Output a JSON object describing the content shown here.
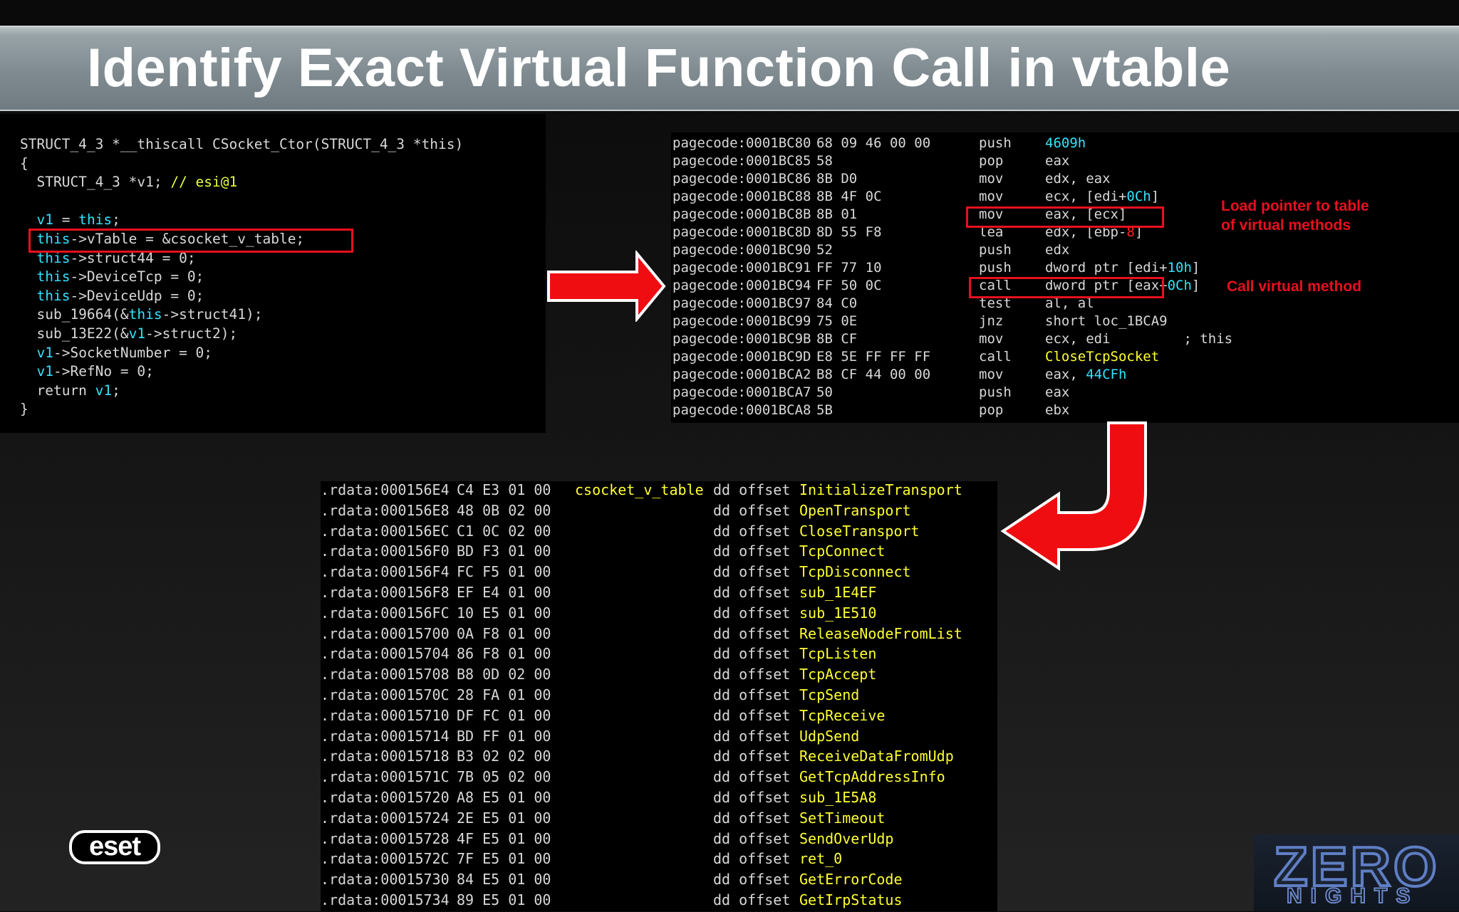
{
  "slide": {
    "title": "Identify Exact Virtual Function Call in vtable"
  },
  "annotations": {
    "load_pointer": [
      "Load pointer to table",
      "of virtual methods"
    ],
    "call_virtual": "Call virtual method"
  },
  "decompiled": {
    "lines": [
      [
        [
          "STRUCT_4_3 *__thiscall CSocket_Ctor(STRUCT_4_3 *this)",
          ""
        ]
      ],
      [
        [
          "{",
          ""
        ]
      ],
      [
        [
          "  STRUCT_4_3 *v1; ",
          ""
        ],
        [
          "// esi@1",
          "cm"
        ]
      ],
      [
        [
          "",
          ""
        ]
      ],
      [
        [
          "  ",
          ""
        ],
        [
          "v1",
          "kw"
        ],
        [
          " = ",
          ""
        ],
        [
          "this",
          "kw"
        ],
        [
          ";",
          ""
        ]
      ],
      [
        [
          "  ",
          ""
        ],
        [
          "this",
          "kw"
        ],
        [
          "->vTable = &csocket_v_table;",
          ""
        ]
      ],
      [
        [
          "  ",
          ""
        ],
        [
          "this",
          "kw"
        ],
        [
          "->struct44 = 0;",
          ""
        ]
      ],
      [
        [
          "  ",
          ""
        ],
        [
          "this",
          "kw"
        ],
        [
          "->DeviceTcp = 0;",
          ""
        ]
      ],
      [
        [
          "  ",
          ""
        ],
        [
          "this",
          "kw"
        ],
        [
          "->DeviceUdp = 0;",
          ""
        ]
      ],
      [
        [
          "  sub_19664(&",
          ""
        ],
        [
          "this",
          "kw"
        ],
        [
          "->struct41);",
          ""
        ]
      ],
      [
        [
          "  sub_13E22(&",
          ""
        ],
        [
          "v1",
          "kw"
        ],
        [
          "->struct2);",
          ""
        ]
      ],
      [
        [
          "  ",
          ""
        ],
        [
          "v1",
          "kw"
        ],
        [
          "->SocketNumber = 0;",
          ""
        ]
      ],
      [
        [
          "  ",
          ""
        ],
        [
          "v1",
          "kw"
        ],
        [
          "->RefNo = 0;",
          ""
        ]
      ],
      [
        [
          "  return ",
          ""
        ],
        [
          "v1",
          "kw"
        ],
        [
          ";",
          ""
        ]
      ],
      [
        [
          "}",
          ""
        ]
      ]
    ]
  },
  "disasm": {
    "rows": [
      {
        "addr": "pagecode:0001BC80",
        "bytes": "68 09 46 00 00",
        "mnem": "push",
        "ops": [
          [
            "4609h",
            "cyn"
          ]
        ]
      },
      {
        "addr": "pagecode:0001BC85",
        "bytes": "58",
        "mnem": "pop",
        "ops": [
          [
            "eax",
            ""
          ]
        ]
      },
      {
        "addr": "pagecode:0001BC86",
        "bytes": "8B D0",
        "mnem": "mov",
        "ops": [
          [
            "edx, eax",
            ""
          ]
        ]
      },
      {
        "addr": "pagecode:0001BC88",
        "bytes": "8B 4F 0C",
        "mnem": "mov",
        "ops": [
          [
            "ecx, [edi+",
            ""
          ],
          [
            "0Ch",
            "cyn"
          ],
          [
            "]",
            ""
          ]
        ]
      },
      {
        "addr": "pagecode:0001BC8B",
        "bytes": "8B 01",
        "mnem": "mov",
        "ops": [
          [
            "eax, [ecx]",
            ""
          ]
        ]
      },
      {
        "addr": "pagecode:0001BC8D",
        "bytes": "8D 55 F8",
        "mnem": "lea",
        "ops": [
          [
            "edx, [ebp-",
            ""
          ],
          [
            "8",
            "red"
          ],
          [
            "]",
            ""
          ]
        ]
      },
      {
        "addr": "pagecode:0001BC90",
        "bytes": "52",
        "mnem": "push",
        "ops": [
          [
            "edx",
            ""
          ]
        ]
      },
      {
        "addr": "pagecode:0001BC91",
        "bytes": "FF 77 10",
        "mnem": "push",
        "ops": [
          [
            "dword ptr [edi+",
            ""
          ],
          [
            "10h",
            "cyn"
          ],
          [
            "]",
            ""
          ]
        ]
      },
      {
        "addr": "pagecode:0001BC94",
        "bytes": "FF 50 0C",
        "mnem": "call",
        "ops": [
          [
            "dword ptr [eax+",
            ""
          ],
          [
            "0Ch",
            "cyn"
          ],
          [
            "]",
            ""
          ]
        ]
      },
      {
        "addr": "pagecode:0001BC97",
        "bytes": "84 C0",
        "mnem": "test",
        "ops": [
          [
            "al, al",
            ""
          ]
        ]
      },
      {
        "addr": "pagecode:0001BC99",
        "bytes": "75 0E",
        "mnem": "jnz",
        "ops": [
          [
            "short loc_1BCA9",
            ""
          ]
        ]
      },
      {
        "addr": "pagecode:0001BC9B",
        "bytes": "8B CF",
        "mnem": "mov",
        "ops": [
          [
            "ecx, edi         ; this",
            ""
          ]
        ]
      },
      {
        "addr": "pagecode:0001BC9D",
        "bytes": "E8 5E FF FF FF",
        "mnem": "call",
        "ops": [
          [
            "CloseTcpSocket",
            "yel"
          ]
        ]
      },
      {
        "addr": "pagecode:0001BCA2",
        "bytes": "B8 CF 44 00 00",
        "mnem": "mov",
        "ops": [
          [
            "eax, ",
            ""
          ],
          [
            "44CFh",
            "cyn"
          ]
        ]
      },
      {
        "addr": "pagecode:0001BCA7",
        "bytes": "50",
        "mnem": "push",
        "ops": [
          [
            "eax",
            ""
          ]
        ]
      },
      {
        "addr": "pagecode:0001BCA8",
        "bytes": "5B",
        "mnem": "pop",
        "ops": [
          [
            "ebx",
            ""
          ]
        ]
      }
    ]
  },
  "vtable": {
    "label": "csocket_v_table",
    "directive": "dd offset",
    "rows": [
      {
        "addr": ".rdata:000156E4",
        "bytes": "C4 E3 01 00",
        "target": "InitializeTransport"
      },
      {
        "addr": ".rdata:000156E8",
        "bytes": "48 0B 02 00",
        "target": "OpenTransport"
      },
      {
        "addr": ".rdata:000156EC",
        "bytes": "C1 0C 02 00",
        "target": "CloseTransport"
      },
      {
        "addr": ".rdata:000156F0",
        "bytes": "BD F3 01 00",
        "target": "TcpConnect"
      },
      {
        "addr": ".rdata:000156F4",
        "bytes": "FC F5 01 00",
        "target": "TcpDisconnect"
      },
      {
        "addr": ".rdata:000156F8",
        "bytes": "EF E4 01 00",
        "target": "sub_1E4EF"
      },
      {
        "addr": ".rdata:000156FC",
        "bytes": "10 E5 01 00",
        "target": "sub_1E510"
      },
      {
        "addr": ".rdata:00015700",
        "bytes": "0A F8 01 00",
        "target": "ReleaseNodeFromList"
      },
      {
        "addr": ".rdata:00015704",
        "bytes": "86 F8 01 00",
        "target": "TcpListen"
      },
      {
        "addr": ".rdata:00015708",
        "bytes": "B8 0D 02 00",
        "target": "TcpAccept"
      },
      {
        "addr": ".rdata:0001570C",
        "bytes": "28 FA 01 00",
        "target": "TcpSend"
      },
      {
        "addr": ".rdata:00015710",
        "bytes": "DF FC 01 00",
        "target": "TcpReceive"
      },
      {
        "addr": ".rdata:00015714",
        "bytes": "BD FF 01 00",
        "target": "UdpSend"
      },
      {
        "addr": ".rdata:00015718",
        "bytes": "B3 02 02 00",
        "target": "ReceiveDataFromUdp"
      },
      {
        "addr": ".rdata:0001571C",
        "bytes": "7B 05 02 00",
        "target": "GetTcpAddressInfo"
      },
      {
        "addr": ".rdata:00015720",
        "bytes": "A8 E5 01 00",
        "target": "sub_1E5A8"
      },
      {
        "addr": ".rdata:00015724",
        "bytes": "2E E5 01 00",
        "target": "SetTimeout"
      },
      {
        "addr": ".rdata:00015728",
        "bytes": "4F E5 01 00",
        "target": "SendOverUdp"
      },
      {
        "addr": ".rdata:0001572C",
        "bytes": "7F E5 01 00",
        "target": "ret_0"
      },
      {
        "addr": ".rdata:00015730",
        "bytes": "84 E5 01 00",
        "target": "GetErrorCode"
      },
      {
        "addr": ".rdata:00015734",
        "bytes": "89 E5 01 00",
        "target": "GetIrpStatus"
      }
    ]
  },
  "logos": {
    "eset": "eset",
    "zeronights_top": "ZERO",
    "zeronights_bottom": "NIGHTS"
  }
}
